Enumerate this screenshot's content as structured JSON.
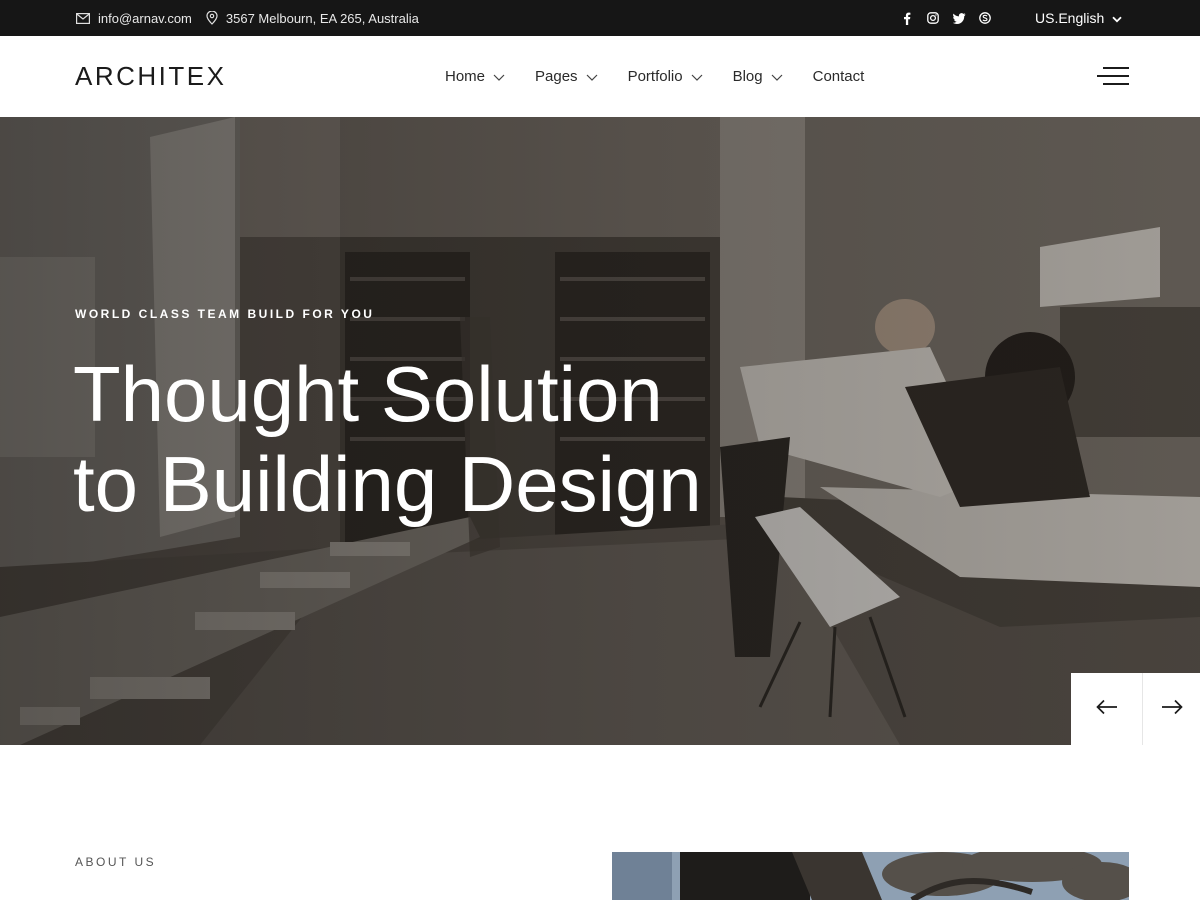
{
  "topbar": {
    "email": "info@arnav.com",
    "address": "3567 Melbourn, EA 265, Australia",
    "social_icons": [
      "facebook-icon",
      "instagram-icon",
      "twitter-icon",
      "skype-icon"
    ],
    "language": "US.English"
  },
  "header": {
    "logo": "ARCHITEX",
    "nav": [
      {
        "label": "Home",
        "has_dropdown": true
      },
      {
        "label": "Pages",
        "has_dropdown": true
      },
      {
        "label": "Portfolio",
        "has_dropdown": true
      },
      {
        "label": "Blog",
        "has_dropdown": true
      },
      {
        "label": "Contact",
        "has_dropdown": false
      }
    ]
  },
  "hero": {
    "eyebrow": "WORLD CLASS TEAM BUILD FOR YOU",
    "headline_line1": "Thought Solution",
    "headline_line2": "to Building Design",
    "prev_icon": "arrow-left-icon",
    "next_icon": "arrow-right-icon"
  },
  "about": {
    "label": "ABOUT US"
  },
  "colors": {
    "topbar_bg": "#161616",
    "text_dark": "#1b1b1b",
    "white": "#ffffff"
  }
}
